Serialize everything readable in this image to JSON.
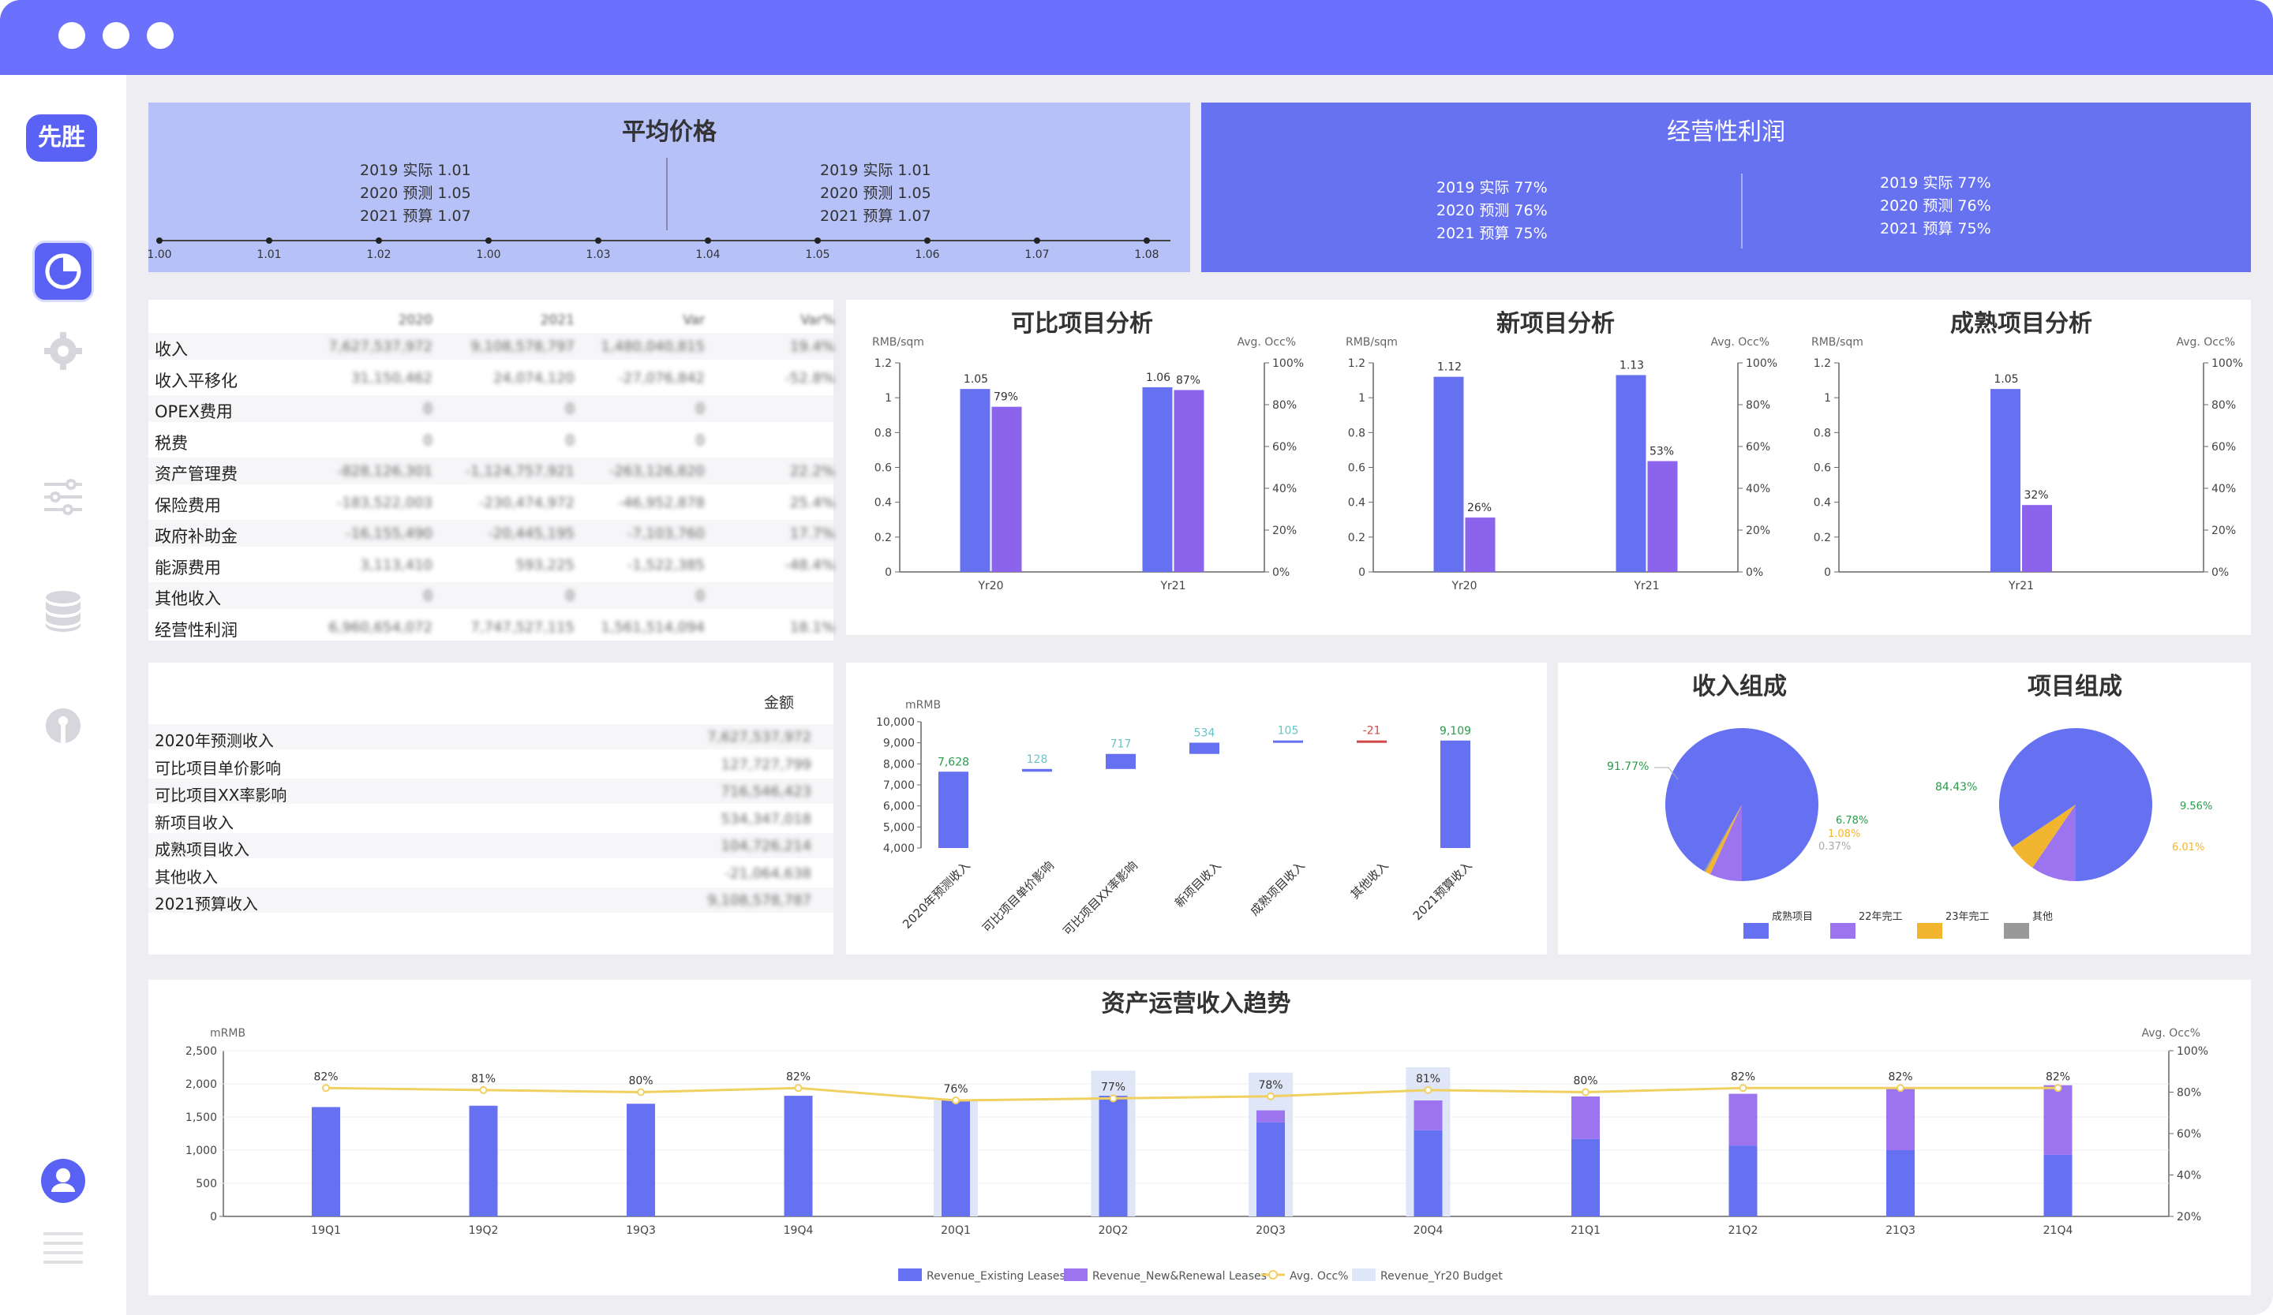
{
  "app": {
    "logo_text": "先胜"
  },
  "avg_price": {
    "title": "平均价格",
    "left": [
      "2019 实际 1.01",
      "2020 预测 1.05",
      "2021 预算 1.07"
    ],
    "right": [
      "2019 实际 1.01",
      "2020 预测 1.05",
      "2021 预算 1.07"
    ],
    "ticks": [
      "1.00",
      "1.01",
      "1.02",
      "1.00",
      "1.03",
      "1.04",
      "1.05",
      "1.06",
      "1.07",
      "1.08"
    ]
  },
  "op_profit": {
    "title": "经营性利润",
    "left": [
      "2019 实际 77%",
      "2020 预测 76%",
      "2021 预算 75%"
    ],
    "right": [
      "2019 实际 77%",
      "2020 预测 76%",
      "2021 预算 75%"
    ]
  },
  "pl_table": {
    "headers": [
      "2020",
      "2021",
      "Var",
      "Var%"
    ],
    "rows": [
      {
        "label": "收入",
        "cells": [
          "7,627,537,972",
          "9,108,578,797",
          "1,480,040,815",
          "19.4%"
        ]
      },
      {
        "label": "收入平移化",
        "cells": [
          "31,150,462",
          "24,074,120",
          "-27,076,842",
          "-52.8%"
        ]
      },
      {
        "label": "OPEX费用",
        "cells": [
          "0",
          "0",
          "0",
          ""
        ]
      },
      {
        "label": "税费",
        "cells": [
          "0",
          "0",
          "0",
          ""
        ]
      },
      {
        "label": "资产管理费",
        "cells": [
          "-828,126,301",
          "-1,124,757,921",
          "-263,126,820",
          "22.2%"
        ]
      },
      {
        "label": "保险费用",
        "cells": [
          "-183,522,003",
          "-230,474,972",
          "-46,952,878",
          "25.4%"
        ]
      },
      {
        "label": "政府补助金",
        "cells": [
          "-16,155,490",
          "-20,445,195",
          "-7,103,760",
          "17.7%"
        ]
      },
      {
        "label": "能源费用",
        "cells": [
          "3,113,410",
          "593,225",
          "-1,522,385",
          "-48.4%"
        ]
      },
      {
        "label": "其他收入",
        "cells": [
          "0",
          "0",
          "0",
          ""
        ]
      },
      {
        "label": "经营性利润",
        "cells": [
          "6,960,654,072",
          "7,747,527,115",
          "1,561,514,094",
          "18.1%"
        ]
      }
    ]
  },
  "bridge_table": {
    "header": "金额",
    "rows": [
      {
        "label": "2020年预测收入",
        "value": "7,627,537,972"
      },
      {
        "label": "可比项目单价影响",
        "value": "127,727,799"
      },
      {
        "label": "可比项目XX率影响",
        "value": "716,546,423"
      },
      {
        "label": "新项目收入",
        "value": "534,347,018"
      },
      {
        "label": "成熟项目收入",
        "value": "104,726,214"
      },
      {
        "label": "其他收入",
        "value": "-21,064,638"
      },
      {
        "label": "2021预算收入",
        "value": "9,108,578,787"
      }
    ]
  },
  "chart_data": [
    {
      "type": "bar",
      "title": "可比项目分析",
      "categories": [
        "Yr20",
        "Yr21"
      ],
      "y_left_unit": "RMB/sqm",
      "y_right_unit": "Avg. Occ%",
      "ylim": [
        0,
        1.2
      ],
      "y2lim": [
        0,
        100
      ],
      "series": [
        {
          "values": [
            1.05,
            1.06
          ],
          "labels": [
            "1.05",
            "1.06"
          ]
        },
        {
          "values": [
            79,
            87
          ],
          "labels": [
            "79%",
            "87%"
          ],
          "axis": "right"
        }
      ]
    },
    {
      "type": "bar",
      "title": "新项目分析",
      "categories": [
        "Yr20",
        "Yr21"
      ],
      "y_left_unit": "RMB/sqm",
      "y_right_unit": "Avg. Occ%",
      "ylim": [
        0,
        1.2
      ],
      "y2lim": [
        0,
        100
      ],
      "series": [
        {
          "values": [
            1.12,
            1.13
          ],
          "labels": [
            "1.12",
            "1.13"
          ]
        },
        {
          "values": [
            26,
            53
          ],
          "labels": [
            "26%",
            "53%"
          ],
          "axis": "right"
        }
      ]
    },
    {
      "type": "bar",
      "title": "成熟项目分析",
      "categories": [
        "Yr21"
      ],
      "y_left_unit": "RMB/sqm",
      "y_right_unit": "Avg. Occ%",
      "ylim": [
        0,
        1.2
      ],
      "y2lim": [
        0,
        100
      ],
      "series": [
        {
          "values": [
            1.05
          ],
          "labels": [
            "1.05"
          ]
        },
        {
          "values": [
            32
          ],
          "labels": [
            "32%"
          ],
          "axis": "right"
        }
      ]
    },
    {
      "type": "waterfall",
      "y_unit": "mRMB",
      "ylim": [
        4000,
        10000
      ],
      "categories": [
        "2020年预测收入",
        "可比项目单价影响",
        "可比项目XX率影响",
        "新项目收入",
        "成熟项目收入",
        "其他收入",
        "2021预算收入"
      ],
      "values": [
        7628,
        128,
        717,
        534,
        105,
        -21,
        9109
      ],
      "labels": [
        "7,628",
        "128",
        "717",
        "534",
        "105",
        "-21",
        "9,109"
      ]
    },
    {
      "type": "pie",
      "title": "收入组成",
      "slices": [
        {
          "name": "成熟项目",
          "value": 91.77,
          "label": "91.77%"
        },
        {
          "name": "22年完工",
          "value": 6.78,
          "label": "6.78%"
        },
        {
          "name": "23年完工",
          "value": 1.08,
          "label": "1.08%"
        },
        {
          "name": "其他",
          "value": 0.37,
          "label": "0.37%"
        }
      ]
    },
    {
      "type": "pie",
      "title": "项目组成",
      "slices": [
        {
          "name": "成熟项目",
          "value": 84.43,
          "label": "84.43%"
        },
        {
          "name": "22年完工",
          "value": 9.56,
          "label": "9.56%"
        },
        {
          "name": "23年完工",
          "value": 6.01,
          "label": "6.01%"
        }
      ]
    },
    {
      "type": "bar",
      "title": "资产运营收入趋势",
      "y_left_unit": "mRMB",
      "y_right_unit": "Avg. Occ%",
      "ylim": [
        0,
        2500
      ],
      "y2lim": [
        20,
        100
      ],
      "categories": [
        "19Q1",
        "19Q2",
        "19Q3",
        "19Q4",
        "20Q1",
        "20Q2",
        "20Q3",
        "20Q4",
        "21Q1",
        "21Q2",
        "21Q3",
        "21Q4"
      ],
      "series": [
        {
          "name": "Revenue_Existing Leases",
          "values": [
            1650,
            1670,
            1700,
            1820,
            1760,
            1820,
            1420,
            1300,
            1170,
            1070,
            1000,
            930
          ]
        },
        {
          "name": "Revenue_New&Renewal Leases",
          "values": [
            0,
            0,
            0,
            0,
            0,
            0,
            180,
            450,
            640,
            780,
            930,
            1050
          ]
        },
        {
          "name": "Avg. Occ%",
          "values": [
            82,
            81,
            80,
            82,
            76,
            77,
            78,
            81,
            80,
            82,
            82,
            82
          ],
          "labels": [
            "82%",
            "81%",
            "80%",
            "82%",
            "76%",
            "77%",
            "78%",
            "81%",
            "80%",
            "82%",
            "82%",
            "82%"
          ]
        },
        {
          "name": "Revenue_Yr20 Budget",
          "values": [
            0,
            0,
            0,
            0,
            1750,
            2200,
            2170,
            2250,
            0,
            0,
            0,
            0
          ]
        }
      ]
    }
  ],
  "colors": {
    "brand": "#6b70fd",
    "bar_primary": "#6671f1",
    "bar_secondary": "#8b63ec",
    "occ_line": "#f0d060",
    "budget": "#dfe6f7",
    "pie_orange": "#f2b52f",
    "pie_gray": "#999999"
  }
}
